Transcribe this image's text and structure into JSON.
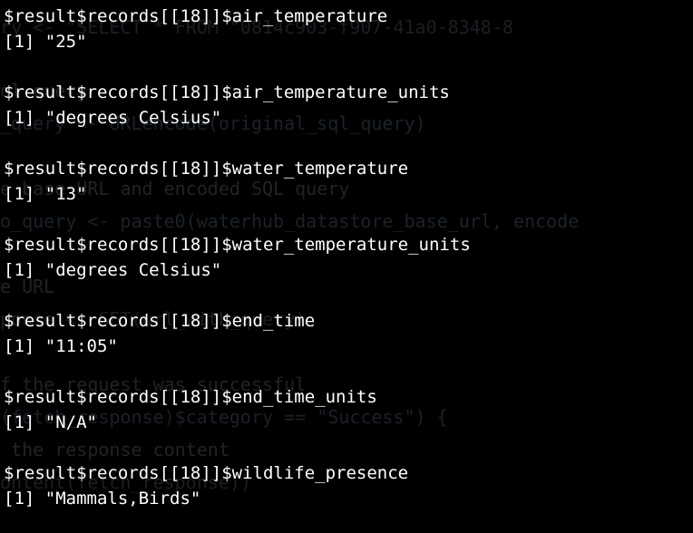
{
  "console": {
    "entries": [
      {
        "accessor": "$result$records[[18]]$air_temperature",
        "value": "[1] \"25\""
      },
      {
        "accessor": "$result$records[[18]]$air_temperature_units",
        "value": "[1] \"degrees Celsius\""
      },
      {
        "accessor": "$result$records[[18]]$water_temperature",
        "value": "[1] \"13\""
      },
      {
        "accessor": "$result$records[[18]]$water_temperature_units",
        "value": "[1] \"degrees Celsius\""
      },
      {
        "accessor": "$result$records[[18]]$end_time",
        "value": "[1] \"11:05\""
      },
      {
        "accessor": "$result$records[[18]]$end_time_units",
        "value": "[1] \"N/A\""
      },
      {
        "accessor": "$result$records[[18]]$wildlife_presence",
        "value": "[1] \"Mammals,Birds\""
      }
    ]
  },
  "background_code": {
    "lines": [
      "ry <- \"SELECT * FROM \"0814c903-f907-41a0-8348-8",
      "ql query",
      "_query <- URLencode(original_sql_query)",
      "",
      "e base URL and encoded SQL query",
      "o_query <- paste0(waterhub_datastore_base_url, encode",
      "e URL",
      "ponse <- GET(url_with_query)",
      "",
      "f the request was successful",
      "(fetch_response)$category == \"Success\") {",
      " the response content",
      "ontent(fetch_response))"
    ]
  }
}
